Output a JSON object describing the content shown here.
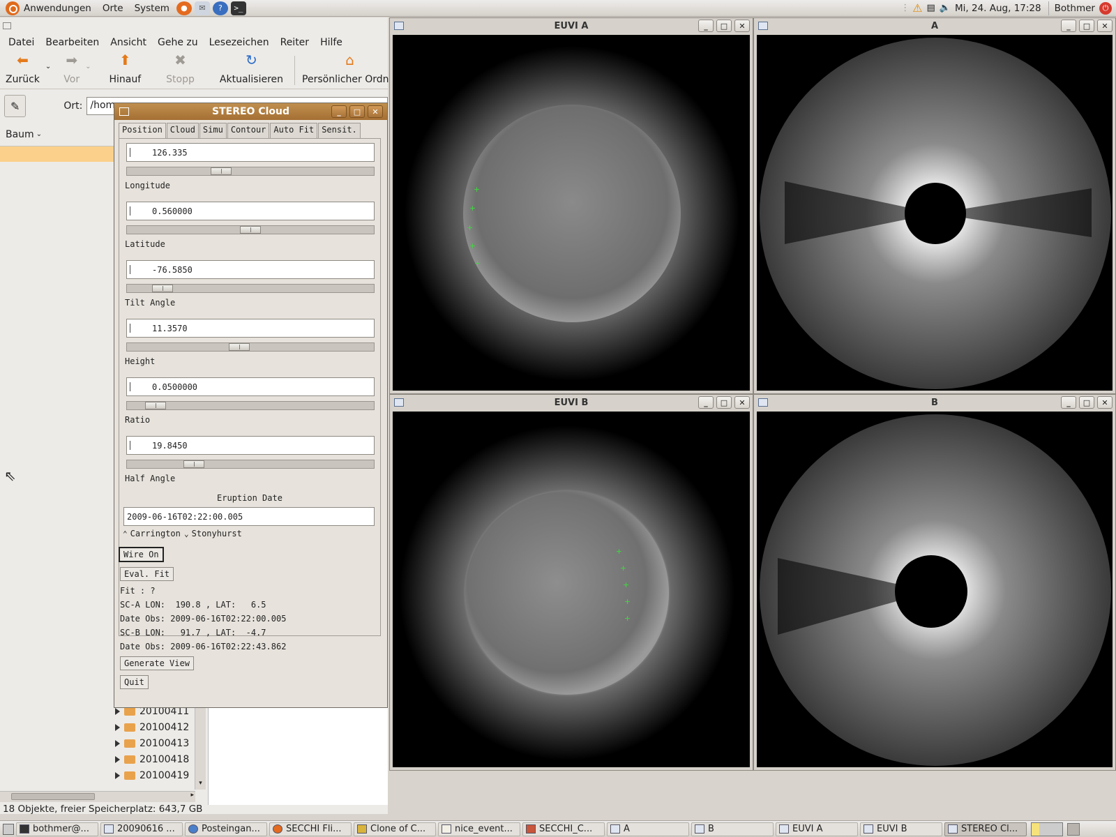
{
  "top_panel": {
    "menus": [
      "Anwendungen",
      "Orte",
      "System"
    ],
    "clock": "Mi, 24. Aug, 17:28",
    "user": "Bothmer"
  },
  "file_manager": {
    "menu": [
      "Datei",
      "Bearbeiten",
      "Ansicht",
      "Gehe zu",
      "Lesezeichen",
      "Reiter",
      "Hilfe"
    ],
    "toolbar": {
      "back": "Zurück",
      "forward": "Vor",
      "up": "Hinauf",
      "stop": "Stopp",
      "reload": "Aktualisieren",
      "home": "Persönlicher Ordner"
    },
    "location_label": "Ort:",
    "location_value": "/hom",
    "side_pane_mode": "Baum",
    "tree_items": [
      "20100411",
      "20100412",
      "20100413",
      "20100418",
      "20100419"
    ],
    "status": "18 Objekte, freier Speicherplatz: 643,7 GB"
  },
  "image_windows": [
    {
      "title": "EUVI A"
    },
    {
      "title": "A"
    },
    {
      "title": "EUVI B"
    },
    {
      "title": "B"
    }
  ],
  "stereo_cloud": {
    "title": "STEREO Cloud",
    "tabs": [
      "Position",
      "Cloud",
      "Simu",
      "Contour",
      "Auto Fit",
      "Sensit."
    ],
    "fields": [
      {
        "label": "Longitude",
        "value": "126.335",
        "slider": 0.37
      },
      {
        "label": "Latitude",
        "value": "0.560000",
        "slider": 0.5
      },
      {
        "label": "Tilt Angle",
        "value": "-76.5850",
        "slider": 0.11
      },
      {
        "label": "Height",
        "value": "11.3570",
        "slider": 0.45
      },
      {
        "label": "Ratio",
        "value": "0.0500000",
        "slider": 0.08
      },
      {
        "label": "Half Angle",
        "value": "19.8450",
        "slider": 0.25
      }
    ],
    "eruption_label": "Eruption Date",
    "eruption_value": "2009-06-16T02:22:00.005",
    "radio_carrington": "Carrington",
    "radio_stonyhurst": "Stonyhurst",
    "wire_on": "Wire On",
    "eval_fit": "Eval. Fit",
    "fit": "Fit : ?",
    "sca_pos": "SC-A LON:  190.8 , LAT:   6.5",
    "sca_date": "Date Obs: 2009-06-16T02:22:00.005",
    "scb_pos": "SC-B LON:   91.7 , LAT:  -4.7",
    "scb_date": "Date Obs: 2009-06-16T02:22:43.862",
    "generate_view": "Generate View",
    "quit": "Quit"
  },
  "taskbar": [
    "bothmer@...",
    "20090616 ...",
    "Posteingan...",
    "SECCHI Fli...",
    "Clone of C...",
    "nice_event...",
    "SECCHI_C...",
    "A",
    "B",
    "EUVI A",
    "EUVI B",
    "STEREO Cl..."
  ]
}
